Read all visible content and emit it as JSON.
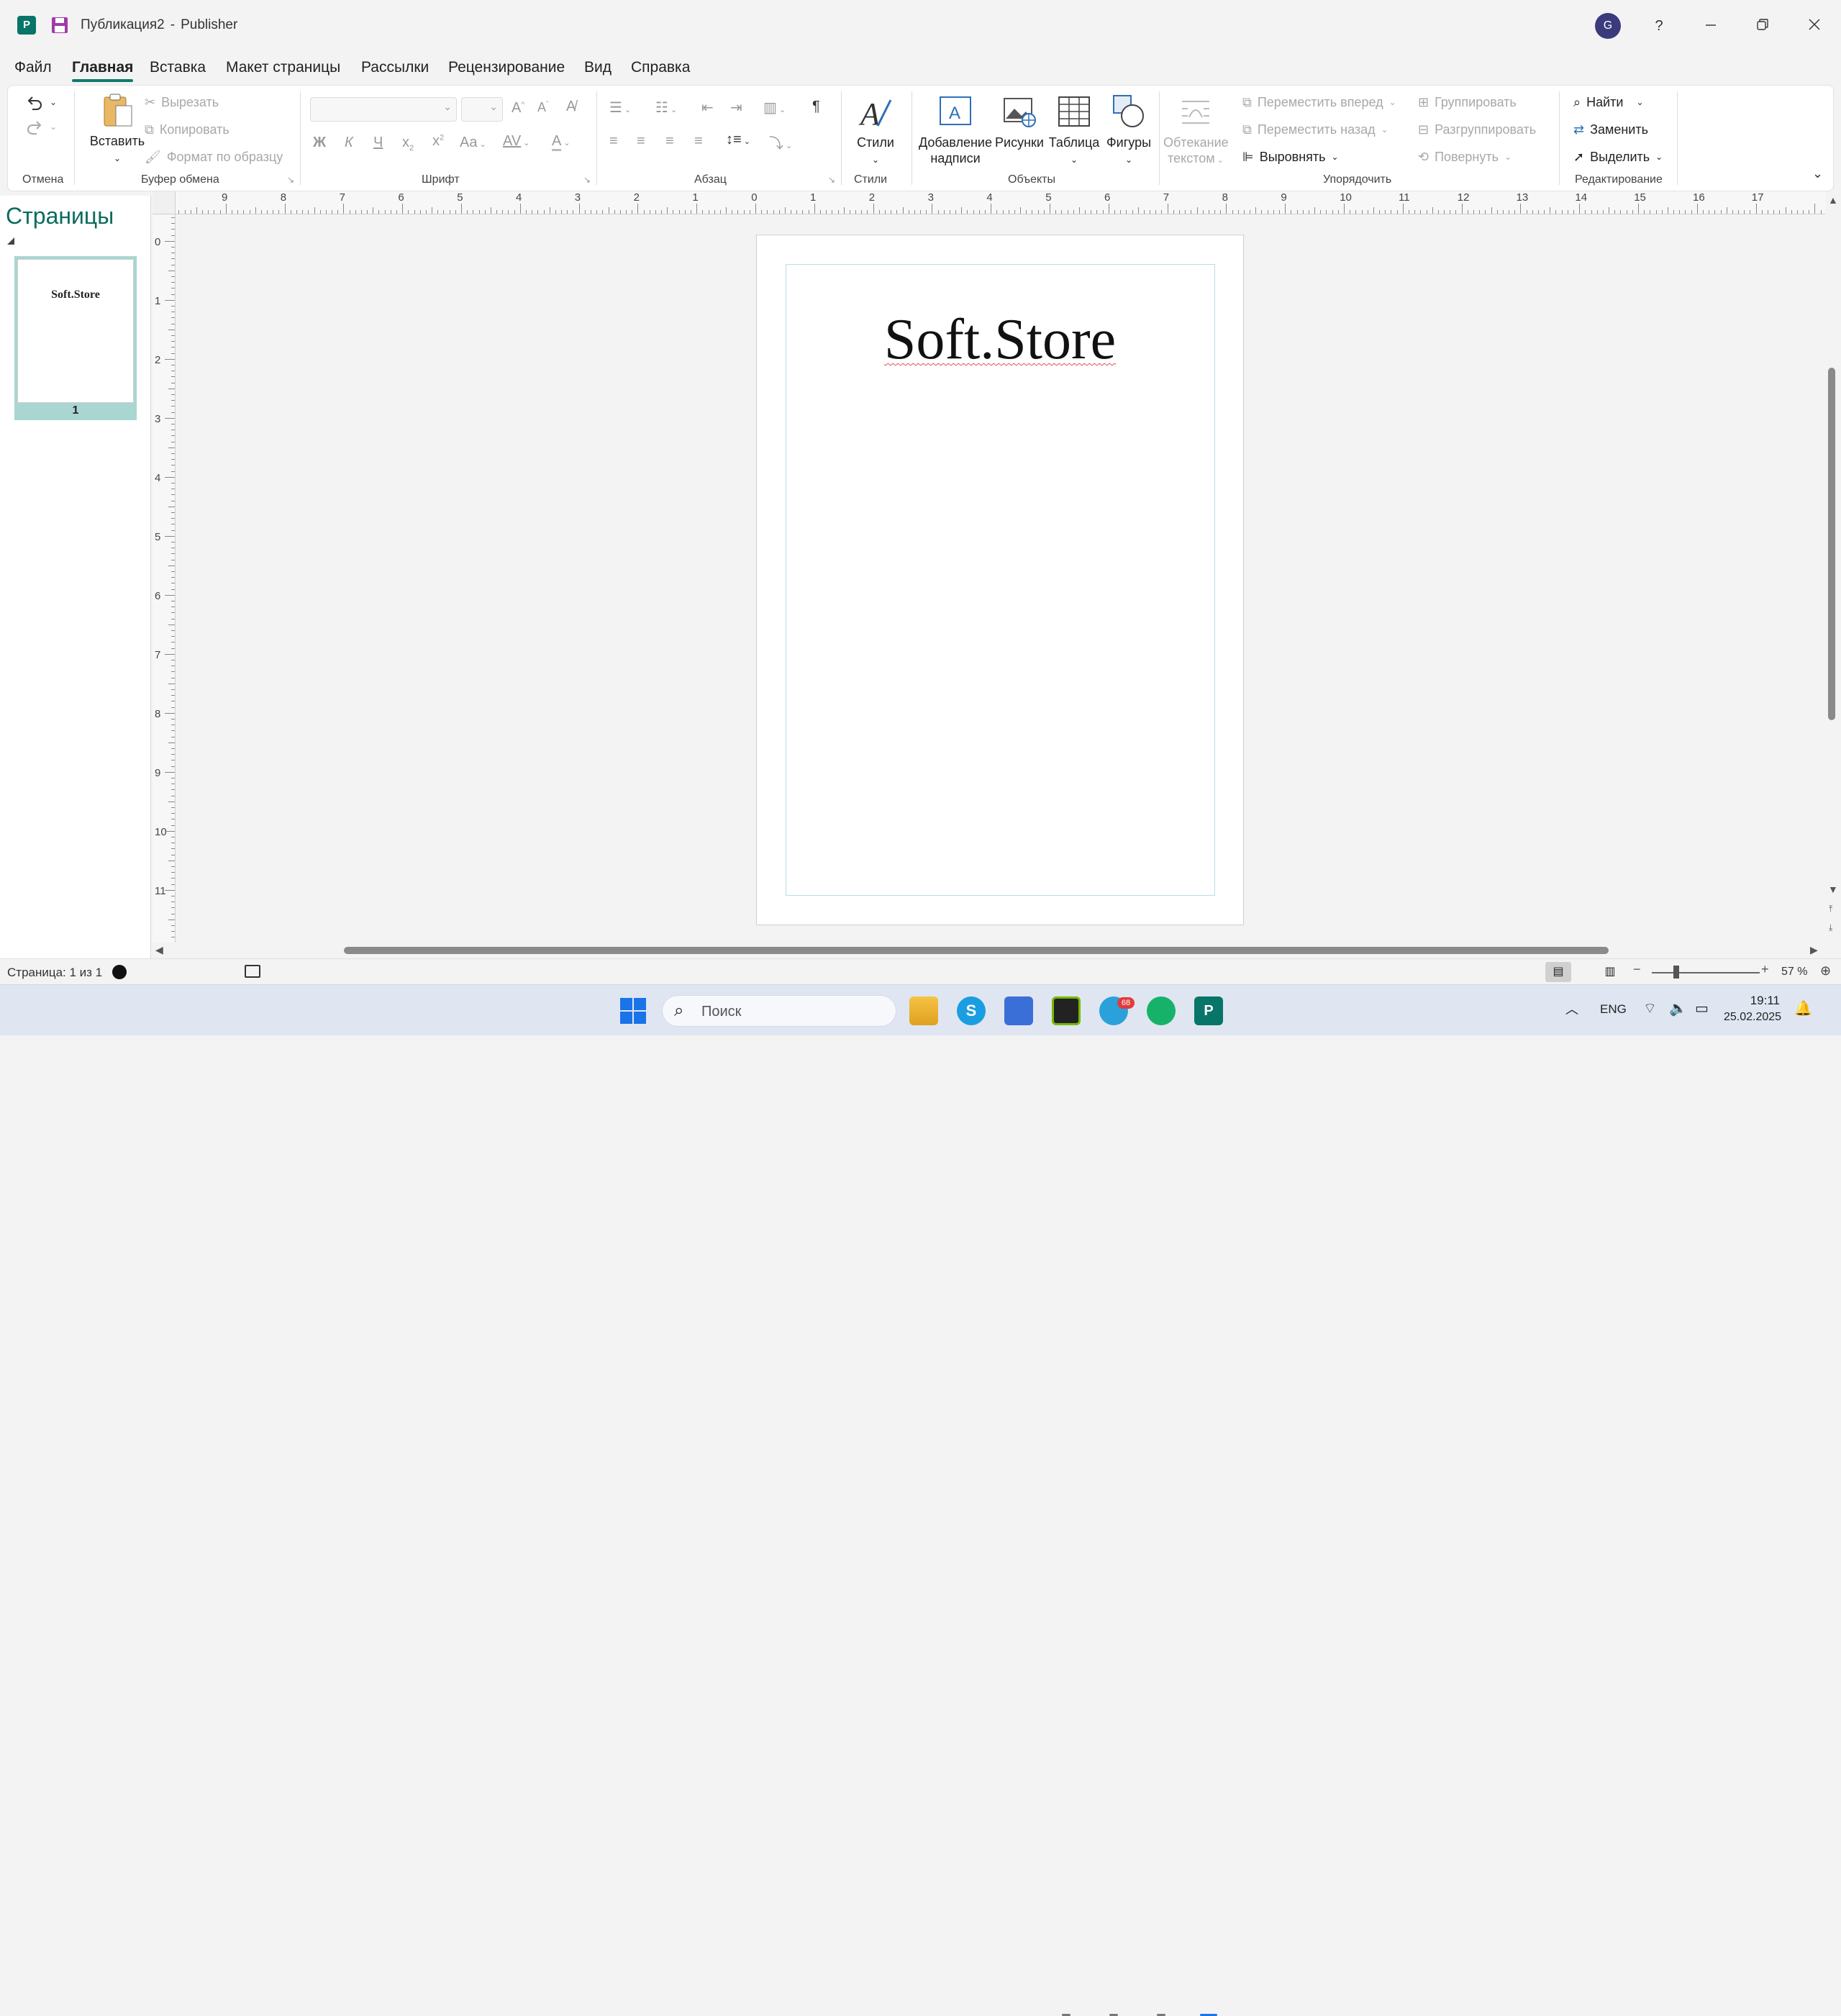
{
  "window": {
    "doc_name": "Публикация2",
    "separator": "-",
    "app_name": "Publisher",
    "user_initial": "G",
    "help": "?"
  },
  "menu": {
    "tabs": [
      "Файл",
      "Главная",
      "Вставка",
      "Макет страницы",
      "Рассылки",
      "Рецензирование",
      "Вид",
      "Справка"
    ],
    "active": "Главная"
  },
  "ribbon": {
    "undo": {
      "group": "Отмена"
    },
    "clipboard": {
      "group": "Буфер обмена",
      "paste": "Вставить",
      "cut": "Вырезать",
      "copy": "Копировать",
      "format_painter": "Формат по образцу"
    },
    "font": {
      "group": "Шрифт",
      "bold": "Ж",
      "italic": "К",
      "underline": "Ч",
      "case": "Aa",
      "spacing": "AV",
      "font_color": "A"
    },
    "paragraph": {
      "group": "Абзац",
      "pilcrow": "¶"
    },
    "styles": {
      "group": "Стили",
      "button": "Стили"
    },
    "objects": {
      "group": "Объекты",
      "textbox_line1": "Добавление",
      "textbox_line2": "надписи",
      "pictures": "Рисунки",
      "table": "Таблица",
      "shapes": "Фигуры"
    },
    "arrange": {
      "group": "Упорядочить",
      "wrap_line1": "Обтекание",
      "wrap_line2": "текстом",
      "bring_forward": "Переместить вперед",
      "send_backward": "Переместить назад",
      "align": "Выровнять",
      "group_btn": "Группировать",
      "ungroup": "Разгруппировать",
      "rotate": "Повернуть"
    },
    "editing": {
      "group": "Редактирование",
      "find": "Найти",
      "replace": "Заменить",
      "select": "Выделить"
    }
  },
  "pages_pane": {
    "title": "Страницы",
    "thumb_text": "Soft.Store",
    "page_number": "1"
  },
  "rulers": {
    "horizontal": [
      "9",
      "8",
      "7",
      "6",
      "5",
      "4",
      "3",
      "2",
      "1",
      "0",
      "1",
      "2",
      "3",
      "4",
      "5",
      "6",
      "7",
      "8",
      "9",
      "10",
      "11",
      "12",
      "13",
      "14",
      "15",
      "16",
      "17"
    ],
    "vertical": [
      "0",
      "1",
      "2",
      "3",
      "4",
      "5",
      "6",
      "7",
      "8",
      "9",
      "10",
      "11"
    ]
  },
  "page": {
    "text": "Soft.Store"
  },
  "status": {
    "page_info": "Страница: 1 из 1",
    "zoom": "57 %"
  },
  "taskbar": {
    "search_placeholder": "Поиск",
    "lang": "ENG",
    "time": "19:11",
    "date": "25.02.2025",
    "telegram_badge": "68"
  },
  "colors": {
    "accent": "#0f7b6c",
    "pages_title": "#0b6b5e",
    "thumb_highlight": "#a9d6d0",
    "avatar": "#3a3a7c"
  }
}
